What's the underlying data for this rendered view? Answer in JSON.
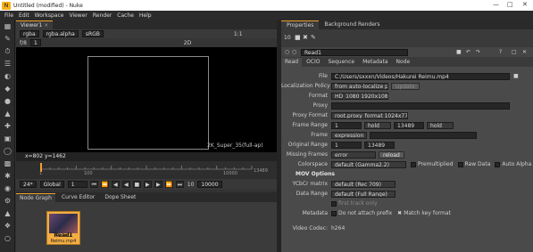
{
  "window": {
    "title": "Untitled (modified) - Nuke"
  },
  "menu": [
    "File",
    "Edit",
    "Workspace",
    "Viewer",
    "Render",
    "Cache",
    "Help"
  ],
  "viewer": {
    "tab_label": "Viewer1",
    "channels": "rgba",
    "layer": "rgba.alpha",
    "colorspace": "sRGB",
    "zoom": "1:1",
    "mode": "2D",
    "frame_counter": "f/8",
    "gain_value": "1",
    "format_label": "2K_Super_35(full-ap)",
    "coords": "x=802 y=1462"
  },
  "timeline": {
    "ticks": [
      "1",
      "100",
      "10000",
      "13489"
    ],
    "range_mode": "Global",
    "fps": "24*",
    "current_frame": "1",
    "step": "10",
    "end_frame": "10000"
  },
  "nodegraph": {
    "tabs": [
      "Node Graph",
      "Curve Editor",
      "Dope Sheet"
    ],
    "node_label": "Read1",
    "node_sub": "Reimu Reimu.mp4"
  },
  "properties": {
    "tabs": [
      "Properties",
      "Background Renders"
    ],
    "counter": "10",
    "node_name": "Read1",
    "subtabs": [
      "Read",
      "OCIO",
      "Sequence",
      "Metadata",
      "Node"
    ],
    "file": "C:/Users/sxxxn/Videos/Hakurei Reimu.mp4",
    "localization_policy": "from auto-localize path",
    "update_label": "Update",
    "format": "HD_1080 1920x1080",
    "proxy": "",
    "proxy_format": "root.proxy_format 1024x778",
    "frame_range_start": "1",
    "frame_range_end": "13489",
    "before": "hold",
    "after": "hold",
    "frame_mode": "expression",
    "frame_value": "",
    "original_range_start": "1",
    "original_range_end": "13489",
    "missing_frames": "error",
    "reload_label": "reload",
    "colorspace": "default (Gamma2.2)",
    "premultiplied_label": "Premultiplied",
    "raw_data_label": "Raw Data",
    "auto_alpha_label": "Auto Alpha",
    "mov_options_label": "MOV Options",
    "ycbcr_matrix": "default (Rec 709)",
    "data_range": "default (Full Range)",
    "first_track_label": "first track only",
    "metadata_label": "Metadata",
    "do_not_attach_label": "Do not attach prefix",
    "match_key_label": "Match key format",
    "video_codec_label": "Video Codec:",
    "video_codec_value": "h264",
    "labels": {
      "file": "File",
      "localization": "Localization Policy",
      "format": "Format",
      "proxy": "Proxy",
      "proxy_format": "Proxy Format",
      "frame_range": "Frame Range",
      "frame": "Frame",
      "original_range": "Original Range",
      "missing_frames": "Missing Frames",
      "colorspace": "Colorspace",
      "ycbcr": "YCbCr matrix",
      "data_range": "Data Range"
    }
  },
  "colors": {
    "accent": "#f0a030",
    "node": "#f2ad43",
    "panel": "#4a4a4a"
  }
}
